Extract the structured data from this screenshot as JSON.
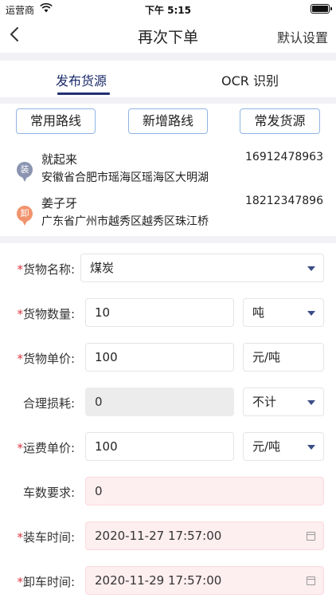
{
  "status": {
    "carrier": "运营商",
    "time": "下午 5:15"
  },
  "nav": {
    "title": "再次下单",
    "right_action": "默认设置"
  },
  "tabs": [
    {
      "label": "发布货源"
    },
    {
      "label": "OCR 识别"
    }
  ],
  "route_buttons": [
    {
      "label": "常用路线"
    },
    {
      "label": "新增路线"
    },
    {
      "label": "常发货源"
    }
  ],
  "load": {
    "badge": "装",
    "name": "就起来",
    "phone": "16912478963",
    "address": "安徽省合肥市瑶海区瑶海区大明湖",
    "color": "#8a94b0"
  },
  "unload": {
    "badge": "卸",
    "name": "姜子牙",
    "phone": "18212347896",
    "address": "广东省广州市越秀区越秀区珠江桥",
    "color": "#f0936d"
  },
  "form": {
    "cargo_name": {
      "required": "*",
      "label": "货物名称:",
      "value": "煤炭"
    },
    "cargo_qty": {
      "required": "*",
      "label": "货物数量:",
      "value": "10",
      "unit": "吨"
    },
    "cargo_price": {
      "required": "*",
      "label": "货物单价:",
      "value": "100",
      "unit": "元/吨"
    },
    "loss": {
      "required": "",
      "label": "合理损耗:",
      "value": "0",
      "option": "不计"
    },
    "freight_price": {
      "required": "*",
      "label": "运费单价:",
      "value": "100",
      "unit": "元/吨"
    },
    "vehicles": {
      "required": "",
      "label": "车数要求:",
      "value": "0"
    },
    "load_time": {
      "required": "*",
      "label": "装车时间:",
      "value": "2020-11-27 17:57:00"
    },
    "unload_time": {
      "required": "*",
      "label": "卸车时间:",
      "value": "2020-11-29 17:57:00"
    }
  }
}
